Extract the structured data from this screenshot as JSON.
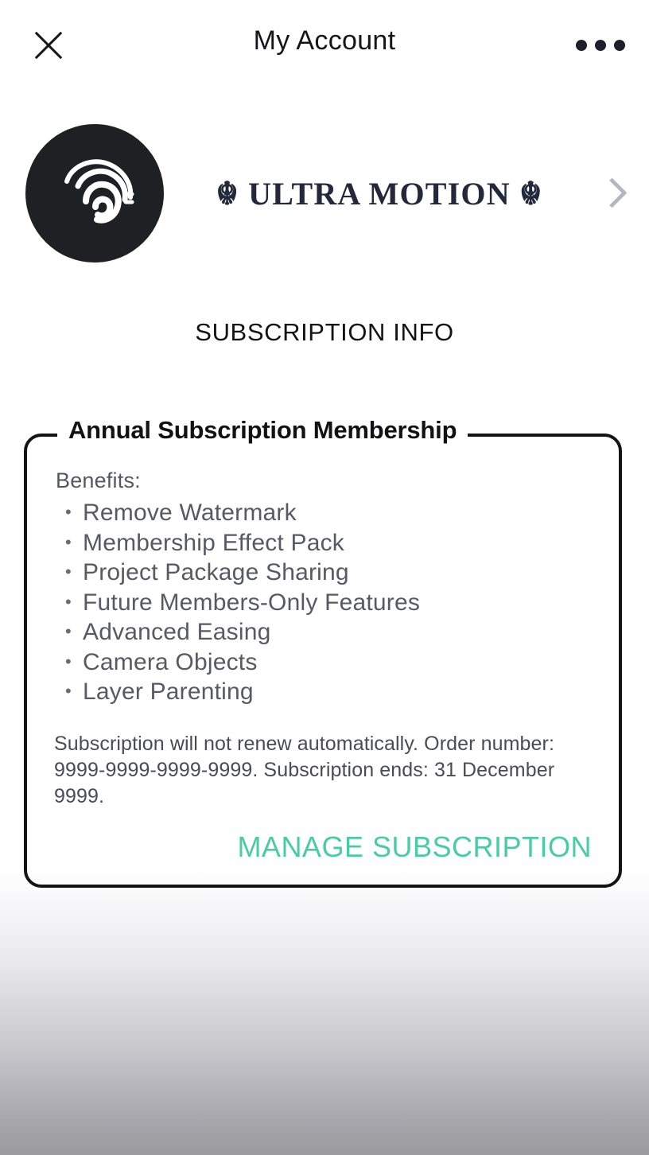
{
  "header": {
    "title": "My Account",
    "close_icon": "close-icon",
    "overflow_icon": "more-options-icon"
  },
  "account": {
    "avatar_icon": "avatar-spiral-logo",
    "brand_name": "☬ ULTRA MOTION ☬",
    "chevron_icon": "chevron-right-icon"
  },
  "section": {
    "heading": "SUBSCRIPTION INFO"
  },
  "card": {
    "legend": "Annual Subscription Membership",
    "benefits_label": "Benefits:",
    "benefits": [
      "Remove Watermark",
      "Membership Effect Pack",
      "Project Package Sharing",
      "Future Members-Only Features",
      "Advanced Easing",
      "Camera Objects",
      "Layer Parenting"
    ],
    "bullet_glyph": "•",
    "fineprint_line1": "Subscription will not renew automatically. Order number:",
    "fineprint_line2": "9999-9999-9999-9999. Subscription ends: 31 December 9999.",
    "manage_label": "MANAGE SUBSCRIPTION"
  },
  "colors": {
    "accent_teal": "#49cca4",
    "card_border": "#141416",
    "avatar_bg": "#1f2023",
    "brand_text": "#23293b",
    "body_text": "#595966",
    "gradient_bottom": "#9b9b9e"
  }
}
